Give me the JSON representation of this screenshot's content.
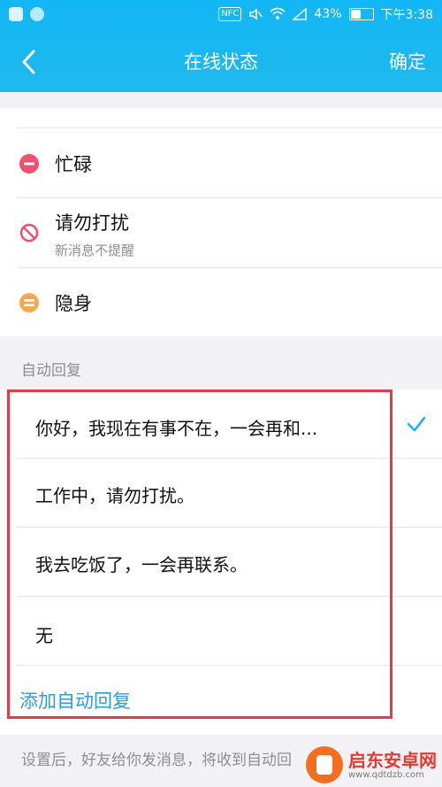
{
  "status_bar": {
    "nfc": "NFC",
    "battery_percent": "43%",
    "battery_level": 0.43,
    "time": "下午3:38"
  },
  "nav": {
    "title": "在线状态",
    "confirm_label": "确定"
  },
  "status_options": [
    {
      "label": "忙碌",
      "sub": "",
      "icon": "minus-circle-icon",
      "color": "#f0506e"
    },
    {
      "label": "请勿打扰",
      "sub": "新消息不提醒",
      "icon": "no-entry-icon",
      "color": "#f0506e"
    },
    {
      "label": "隐身",
      "sub": "",
      "icon": "equals-circle-icon",
      "color": "#f7a84a"
    }
  ],
  "auto_reply": {
    "header": "自动回复",
    "items": [
      {
        "text": "你好，我现在有事不在，一会再和...",
        "selected": true
      },
      {
        "text": "工作中，请勿打扰。",
        "selected": false
      },
      {
        "text": "我去吃饭了，一会再联系。",
        "selected": false
      },
      {
        "text": "无",
        "selected": false
      }
    ],
    "add_label": "添加自动回复",
    "footer": "设置后，好友给你发消息，将收到自动回"
  },
  "watermark": {
    "main": "启东安卓网",
    "sub": "www.qdtdzb.com"
  },
  "colors": {
    "accent": "#12b7f5",
    "link": "#2a9de8",
    "highlight": "#e33b4b",
    "check": "#12b7f5"
  }
}
